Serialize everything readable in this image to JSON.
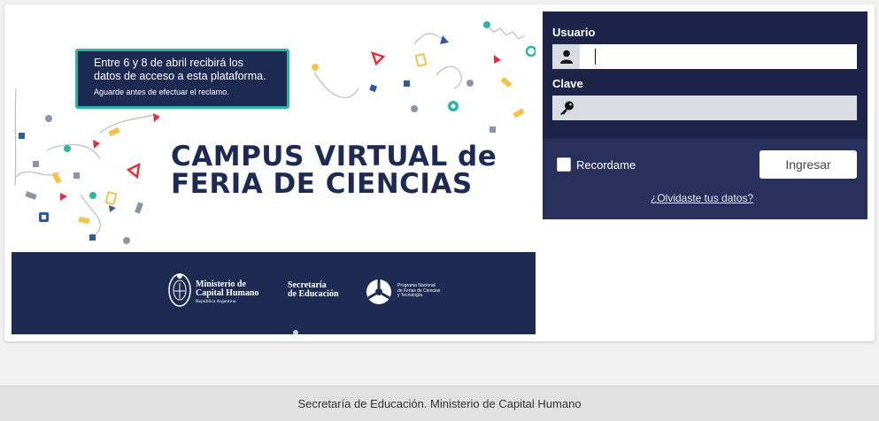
{
  "banner": {
    "notice_line1": "Entre 6 y 8 de abril recibirá los",
    "notice_line2": "datos de acceso a esta plataforma.",
    "notice_small": "Aguarde antes de efectuar el reclamo.",
    "title_line1": "CAMPUS VIRTUAL de",
    "title_line2": "FERIA DE CIENCIAS",
    "ministerio_line1": "Ministerio de",
    "ministerio_line2": "Capital Humano",
    "ministerio_sub": "República Argentina",
    "secretaria_line1": "Secretaría",
    "secretaria_line2": "de Educación",
    "programa_line1": "Programa Nacional",
    "programa_line2": "de Ferias de Ciencias",
    "programa_line3": "y Tecnología"
  },
  "login": {
    "usuario_label": "Usuario",
    "usuario_value": "",
    "clave_label": "Clave",
    "clave_value": "",
    "remember_label": "Recordame",
    "submit_label": "Ingresar",
    "forgot_label": "¿Olvidaste tus datos?"
  },
  "footer": {
    "text": "Secretaría de Educación. Ministerio de Capital Humano"
  },
  "colors": {
    "navy": "#1d2a52",
    "teal": "#2eb3a6",
    "panel": "#29305c",
    "red": "#e0303a",
    "yellow": "#f3c34a"
  }
}
